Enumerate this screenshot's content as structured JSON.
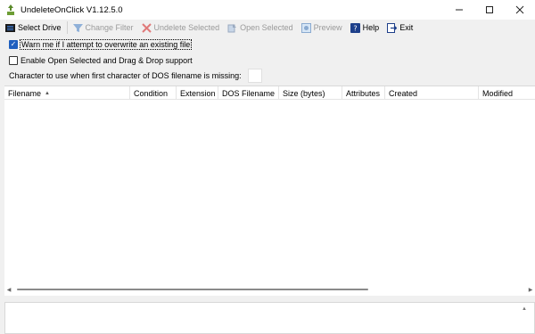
{
  "window": {
    "title": "UndeleteOnClick V1.12.5.0",
    "controls": {
      "minimize": "—",
      "maximize": "☐",
      "close": "✕"
    }
  },
  "toolbar": {
    "items": [
      {
        "label": "Select Drive",
        "icon": "drive-list-icon",
        "enabled": true
      },
      {
        "label": "Change Filter",
        "icon": "filter-icon",
        "enabled": false
      },
      {
        "label": "Undelete Selected",
        "icon": "red-x-icon",
        "enabled": false
      },
      {
        "label": "Open Selected",
        "icon": "open-file-icon",
        "enabled": false
      },
      {
        "label": "Preview",
        "icon": "preview-icon",
        "enabled": false
      },
      {
        "label": "Help",
        "icon": "help-icon",
        "enabled": true
      },
      {
        "label": "Exit",
        "icon": "exit-icon",
        "enabled": true
      }
    ]
  },
  "options": {
    "warn_overwrite": {
      "label": "Warn me if I attempt to overwrite an existing file",
      "checked": true
    },
    "enable_open_drag": {
      "label": "Enable Open Selected and Drag & Drop support",
      "checked": false
    },
    "dos_char": {
      "label": "Character to use when first character of DOS filename is missing:",
      "value": ""
    }
  },
  "list": {
    "columns": [
      "Filename",
      "Condition",
      "Extension",
      "DOS Filename",
      "Size (bytes)",
      "Attributes",
      "Created",
      "Modified"
    ],
    "sort_column": "Filename",
    "sort_direction": "ascending",
    "rows": []
  },
  "colors": {
    "accent": "#1f5fbf",
    "disabled_text": "#9a9a9a"
  }
}
